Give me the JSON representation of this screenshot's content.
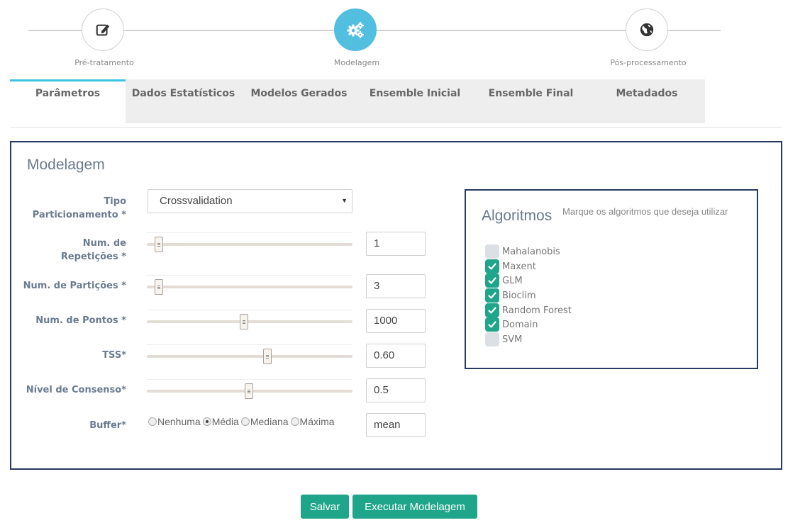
{
  "stepper": {
    "steps": [
      {
        "label": "Pré-tratamento",
        "icon": "edit-icon",
        "active": false
      },
      {
        "label": "Modelagem",
        "icon": "gears-icon",
        "active": true
      },
      {
        "label": "Pós-processamento",
        "icon": "globe-icon",
        "active": false
      }
    ]
  },
  "tabs": [
    {
      "label": "Parâmetros",
      "active": true
    },
    {
      "label": "Dados Estatísticos",
      "active": false
    },
    {
      "label": "Modelos Gerados",
      "active": false
    },
    {
      "label": "Ensemble Inicial",
      "active": false
    },
    {
      "label": "Ensemble Final",
      "active": false
    },
    {
      "label": "Metadados",
      "active": false
    }
  ],
  "panel": {
    "title": "Modelagem",
    "partition": {
      "label_line1": "Tipo",
      "label_line2": "Particionamento *",
      "value": "Crossvalidation"
    },
    "repetitions": {
      "label_line1": "Num. de",
      "label_line2": "Repetições *",
      "value": "1"
    },
    "partitions": {
      "label": "Num. de Partições *",
      "value": "3"
    },
    "points": {
      "label": "Num. de Pontos *",
      "value": "1000"
    },
    "tss": {
      "label": "TSS*",
      "value": "0.60"
    },
    "consensus": {
      "label": "Nível de Consenso*",
      "value": "0.5"
    },
    "buffer": {
      "label": "Buffer*",
      "options": [
        "Nenhuma",
        "Média",
        "Mediana",
        "Máxima"
      ],
      "selected": "Média",
      "value": "mean"
    }
  },
  "algorithms": {
    "title": "Algoritmos",
    "hint": "Marque os algoritmos que deseja utilizar",
    "items": [
      {
        "label": "Mahalanobis",
        "checked": false
      },
      {
        "label": "Maxent",
        "checked": true
      },
      {
        "label": "GLM",
        "checked": true
      },
      {
        "label": "Bioclim",
        "checked": true
      },
      {
        "label": "Random Forest",
        "checked": true
      },
      {
        "label": "Domain",
        "checked": true
      },
      {
        "label": "SVM",
        "checked": false
      }
    ]
  },
  "buttons": {
    "save": "Salvar",
    "run": "Executar Modelagem"
  },
  "colors": {
    "accent": "#52bfe0",
    "primary": "#1fa68a",
    "border": "#26395e"
  }
}
